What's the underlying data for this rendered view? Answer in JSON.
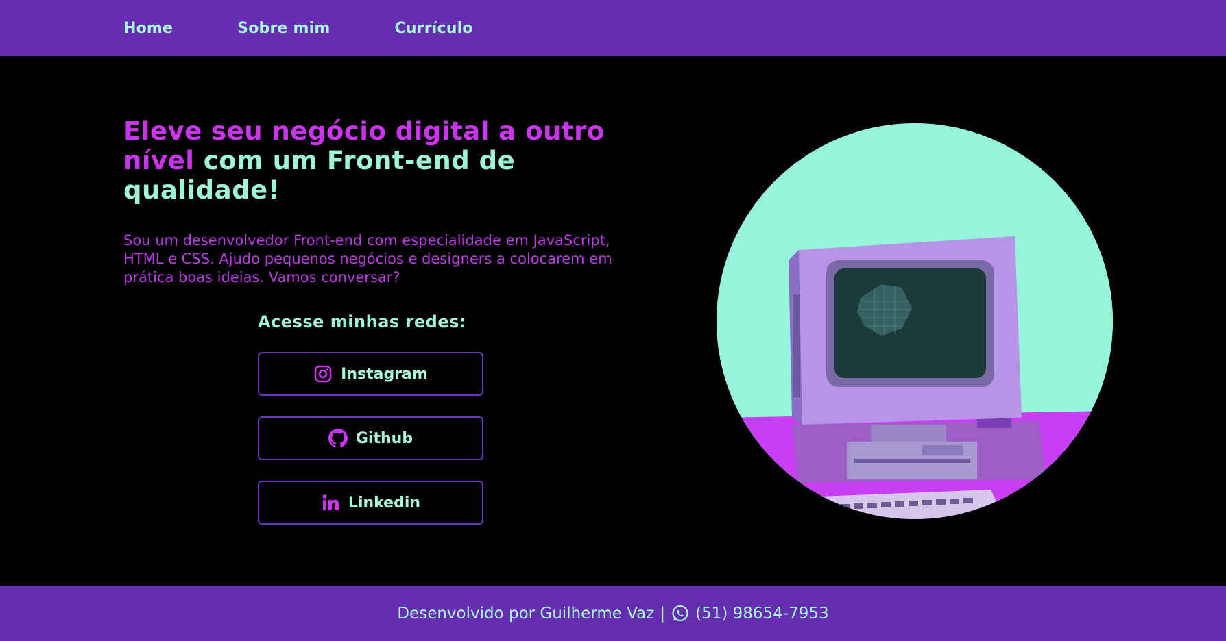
{
  "nav": {
    "items": [
      {
        "label": "Home"
      },
      {
        "label": "Sobre mim"
      },
      {
        "label": "Currículo"
      }
    ]
  },
  "hero": {
    "title_pink": "Eleve seu negócio digital a outro nível",
    "title_mint": " com um Front-end de qualidade!",
    "description": "Sou um desenvolvedor Front-end com especialidade em JavaScript, HTML e CSS. Ajudo pequenos negócios e designers a colocarem em prática boas ideias. Vamos conversar?"
  },
  "socials": {
    "title": "Acesse minhas redes:",
    "items": [
      {
        "label": "Instagram",
        "icon": "instagram-icon"
      },
      {
        "label": "Github",
        "icon": "github-icon"
      },
      {
        "label": "Linkedin",
        "icon": "linkedin-icon"
      }
    ]
  },
  "illustration": {
    "icon": "retro-computer-illustration"
  },
  "footer": {
    "credit": "Desenvolvido por Guilherme Vaz",
    "separator": "|",
    "phone": "(51) 98654-7953",
    "icon": "whatsapp-icon"
  },
  "colors": {
    "nav_bg": "#652db0",
    "accent_pink": "#cc33ee",
    "accent_mint": "#9ef5d9",
    "page_bg": "#000000"
  }
}
